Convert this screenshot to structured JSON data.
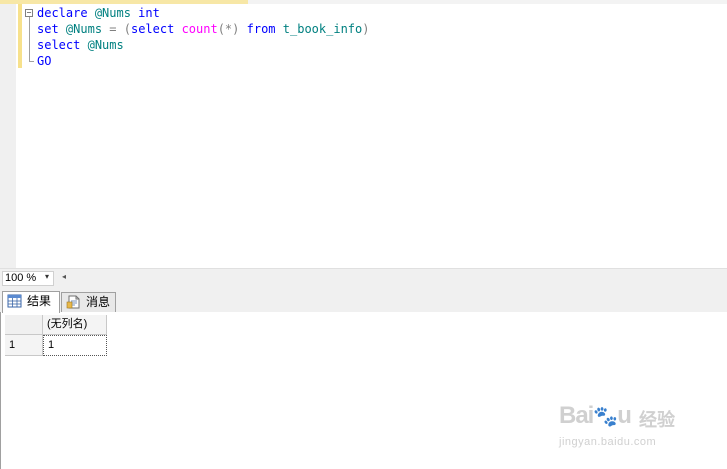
{
  "editor": {
    "lines": [
      {
        "tokens": [
          {
            "t": "declare",
            "c": "kw"
          },
          {
            "t": " ",
            "c": "txt"
          },
          {
            "t": "@Nums",
            "c": "var"
          },
          {
            "t": " ",
            "c": "txt"
          },
          {
            "t": "int",
            "c": "kw"
          }
        ]
      },
      {
        "tokens": [
          {
            "t": "set",
            "c": "kw"
          },
          {
            "t": " ",
            "c": "txt"
          },
          {
            "t": "@Nums",
            "c": "var"
          },
          {
            "t": " ",
            "c": "txt"
          },
          {
            "t": "=",
            "c": "op"
          },
          {
            "t": " ",
            "c": "txt"
          },
          {
            "t": "(",
            "c": "op"
          },
          {
            "t": "select",
            "c": "kw"
          },
          {
            "t": " ",
            "c": "txt"
          },
          {
            "t": "count",
            "c": "fn"
          },
          {
            "t": "(*)",
            "c": "op"
          },
          {
            "t": " ",
            "c": "txt"
          },
          {
            "t": "from",
            "c": "kw"
          },
          {
            "t": " ",
            "c": "txt"
          },
          {
            "t": "t_book_info",
            "c": "obj"
          },
          {
            "t": ")",
            "c": "op"
          }
        ]
      },
      {
        "tokens": [
          {
            "t": "select",
            "c": "kw"
          },
          {
            "t": " ",
            "c": "txt"
          },
          {
            "t": "@Nums",
            "c": "var"
          }
        ]
      },
      {
        "tokens": [
          {
            "t": "GO",
            "c": "kw"
          }
        ]
      }
    ],
    "collapse_glyph": "−"
  },
  "zoom": {
    "value": "100 %",
    "dropdown_glyph": "▾",
    "scroll_left_glyph": "◂"
  },
  "tabs": [
    {
      "label": "结果",
      "icon": "grid-results-icon",
      "active": true
    },
    {
      "label": "消息",
      "icon": "messages-doc-icon",
      "active": false
    }
  ],
  "grid": {
    "columns": [
      "(无列名)"
    ],
    "rows": [
      {
        "row_number": "1",
        "cells": [
          "1"
        ]
      }
    ]
  },
  "watermark": {
    "brand": "Bai",
    "brand_tail": "u",
    "paw": "🐾",
    "sub": "经验",
    "url": "jingyan.baidu.com"
  },
  "colors": {
    "keyword": "#0000ff",
    "variable": "#008080",
    "function": "#ff00ff",
    "operator": "#808080",
    "change_bar": "#f7e18c"
  }
}
